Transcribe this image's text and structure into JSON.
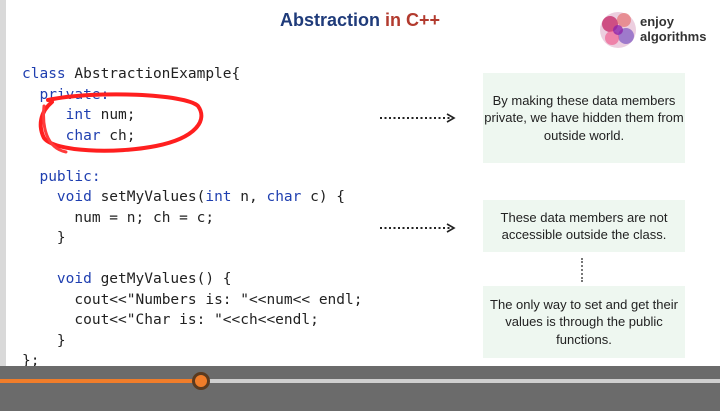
{
  "title": {
    "part1": "Abstraction",
    "part2": " in C++"
  },
  "logo": {
    "line1": "enjoy",
    "line2": "algorithms"
  },
  "code": {
    "l1a": "class",
    "l1b": " AbstractionExample{",
    "l2": "private:",
    "l3a": "int",
    "l3b": " num;",
    "l4a": "char",
    "l4b": " ch;",
    "l5": "public:",
    "l6a": "void",
    "l6b": " setMyValues(",
    "l6c": "int",
    "l6d": " n, ",
    "l6e": "char",
    "l6f": " c) {",
    "l7": "num = n; ch = c;",
    "l8": "}",
    "l9a": "void",
    "l9b": " getMyValues() {",
    "l10": "cout<<\"Numbers is: \"<<num<< endl;",
    "l11": "cout<<\"Char is: \"<<ch<<endl;",
    "l12": "}",
    "l13": "};"
  },
  "notes": {
    "n1": "By making these data members private, we have hidden them from outside world.",
    "n2": "These data members are not accessible outside the class.",
    "n3": "The only way to set and get their values is through the public functions."
  },
  "player": {
    "progress": 0.28,
    "played_color": "#f07d2a"
  }
}
